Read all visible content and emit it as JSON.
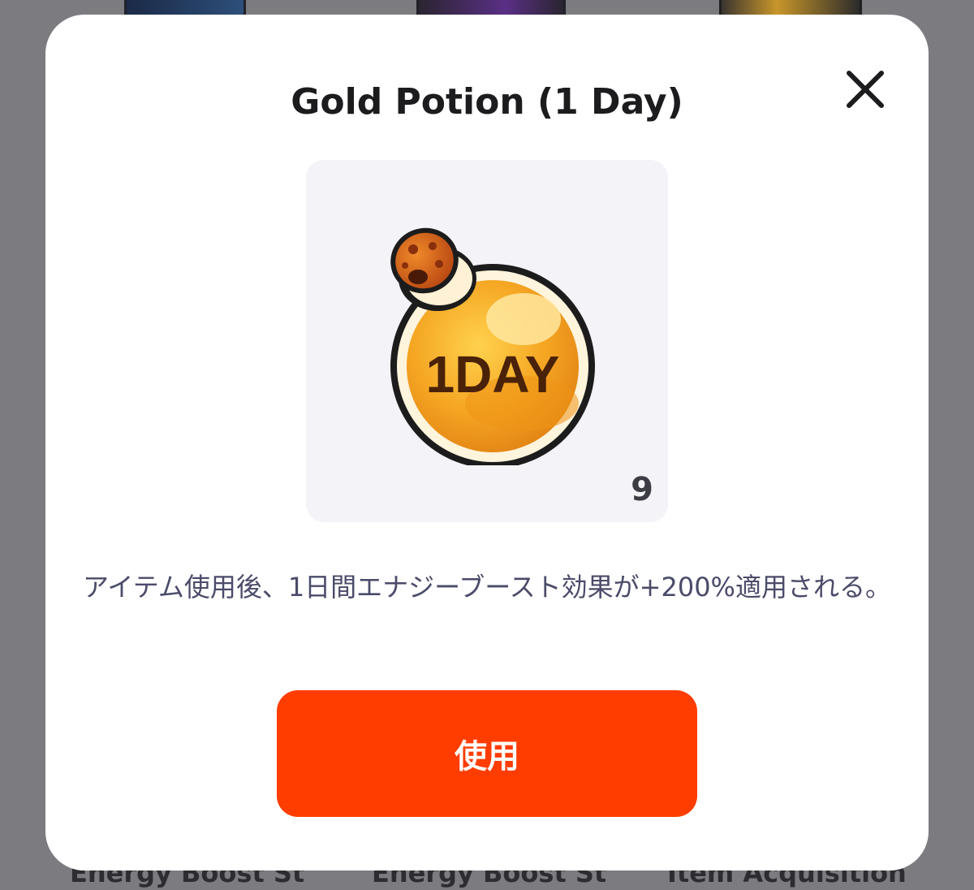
{
  "background": {
    "item_labels": [
      "Energy Boost Sti...",
      "Energy Boost Sti...",
      "Item Acquisition ..."
    ]
  },
  "modal": {
    "title": "Gold Potion (1 Day)",
    "item": {
      "icon_name": "gold-potion-icon",
      "icon_text": "1DAY",
      "count": "9"
    },
    "description": "アイテム使用後、1日間エナジーブースト効果が+200%適用される。",
    "use_button_label": "使用",
    "close_icon_name": "close-icon"
  },
  "colors": {
    "overlay": "#7b7b80",
    "modal_background": "#ffffff",
    "tile_background": "#f3f3f8",
    "accent_button": "#ff3d00",
    "title_text": "#1c1c1e",
    "description_text": "#4b4b6a",
    "potion_gold": "#f5a623",
    "potion_cork": "#d4621a"
  }
}
